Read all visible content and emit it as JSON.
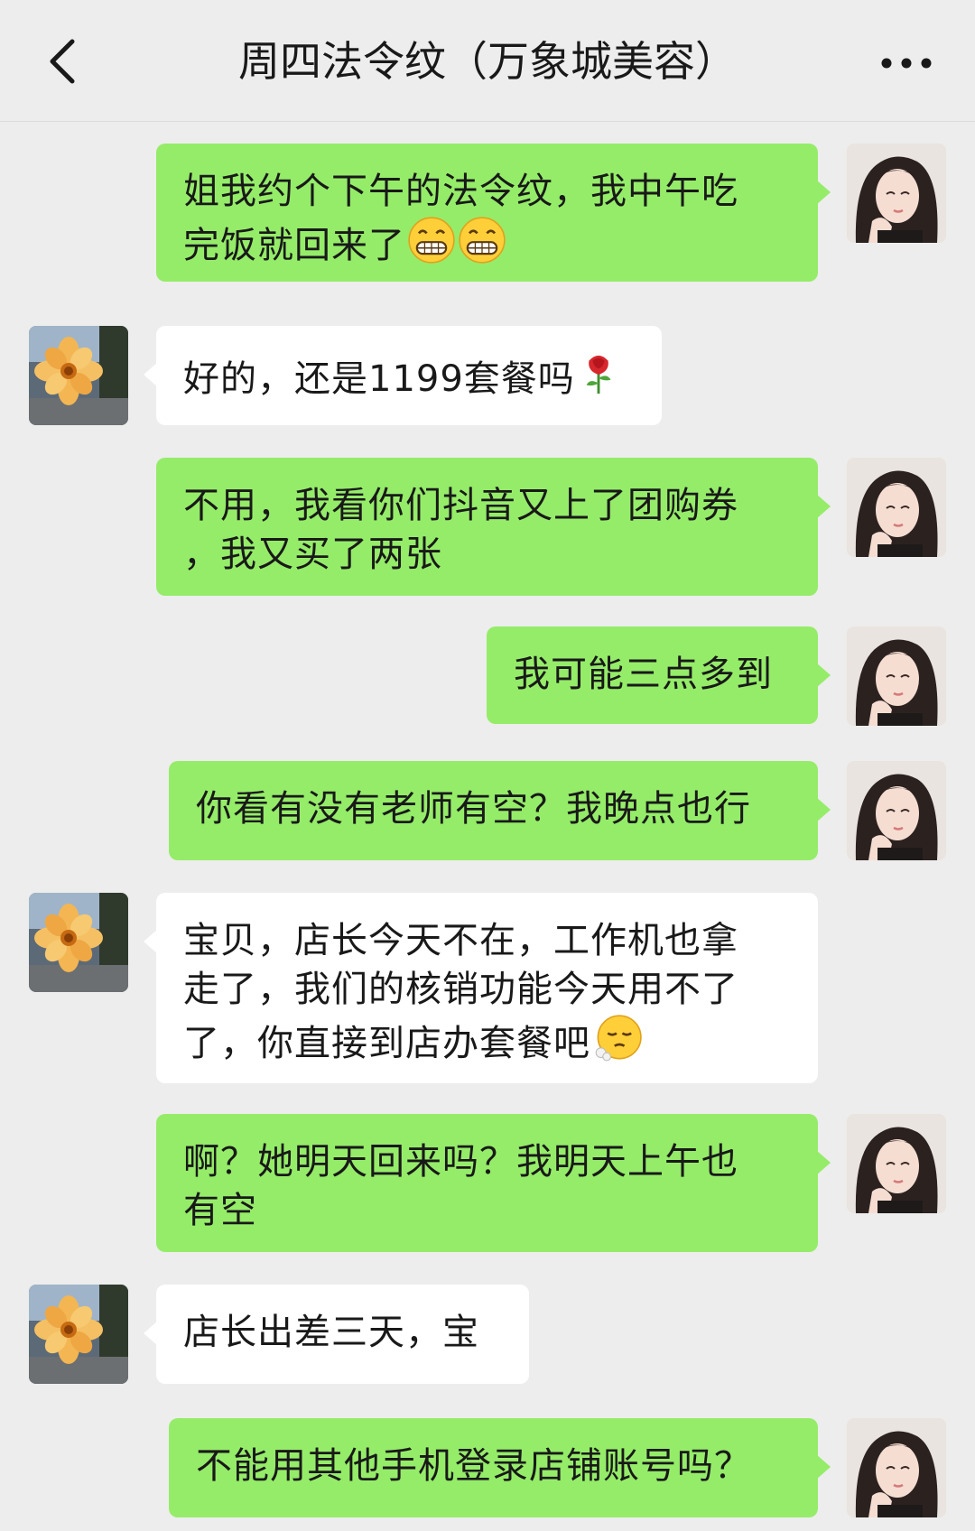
{
  "header": {
    "title": "周四法令纹（万象城美容）",
    "back_icon": "chevron-left-icon",
    "more_icon": "more-dots-icon"
  },
  "colors": {
    "background": "#ededed",
    "self_bubble": "#95ec69",
    "other_bubble": "#ffffff"
  },
  "messages": [
    {
      "sender": "self",
      "lines": [
        "姐我约个下午的法令纹，我中午吃",
        "完饭就回来了"
      ],
      "emoji": [
        "grin-emoji",
        "grin-emoji"
      ]
    },
    {
      "sender": "other",
      "lines": [
        "好的，还是1199套餐吗"
      ],
      "emoji": [
        "rose-emoji"
      ]
    },
    {
      "sender": "self",
      "lines": [
        "不用，我看你们抖音又上了团购券",
        "，我又买了两张"
      ]
    },
    {
      "sender": "self",
      "lines": [
        "我可能三点多到"
      ]
    },
    {
      "sender": "self",
      "lines": [
        "你看有没有老师有空？我晚点也行"
      ]
    },
    {
      "sender": "other",
      "lines": [
        "宝贝，店长今天不在，工作机也拿",
        "走了，我们的核销功能今天用不了",
        "了，你直接到店办套餐吧"
      ],
      "emoji": [
        "sigh-emoji"
      ]
    },
    {
      "sender": "self",
      "lines": [
        "啊？她明天回来吗？我明天上午也",
        "有空"
      ]
    },
    {
      "sender": "other",
      "lines": [
        "店长出差三天，宝"
      ]
    },
    {
      "sender": "self",
      "lines": [
        "不能用其他手机登录店铺账号吗？"
      ]
    }
  ]
}
